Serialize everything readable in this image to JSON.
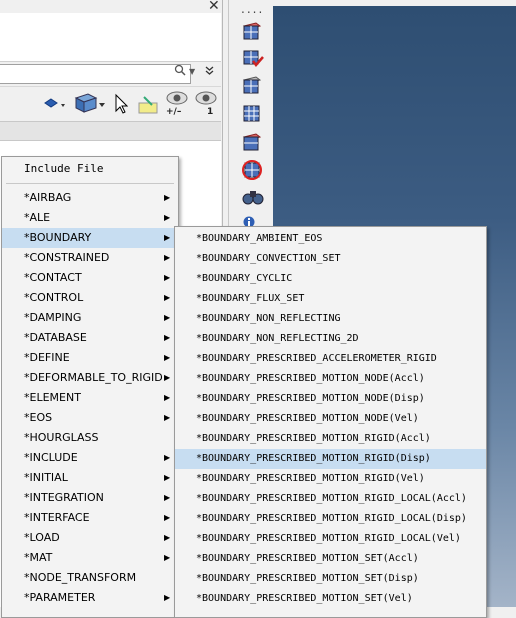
{
  "window": {
    "close_glyph": "✕"
  },
  "search": {
    "value": "",
    "mag_glyph": "🔍",
    "dropdown_glyph": "▼",
    "collapse_glyph": "⌄"
  },
  "toolbar": {
    "icons": [
      "layer-icon",
      "part-display-icon",
      "cursor-select-icon",
      "highlight-icon",
      "view-toggle-icon",
      "view-one-icon"
    ],
    "plusminus_label": "+/–",
    "one_label": "1"
  },
  "vtoolbar": {
    "dots": "....",
    "icons": [
      "mesh-grid-icon",
      "mesh-check-icon",
      "mesh-edit-icon",
      "mesh-grid-2-icon",
      "mesh-face-icon",
      "mesh-circle-icon",
      "binoculars-icon",
      "info-icon"
    ]
  },
  "menu1": {
    "include_label": "Include File",
    "items": [
      {
        "label": "*AIRBAG",
        "sub": true
      },
      {
        "label": "*ALE",
        "sub": true
      },
      {
        "label": "*BOUNDARY",
        "sub": true,
        "selected": true
      },
      {
        "label": "*CONSTRAINED",
        "sub": true
      },
      {
        "label": "*CONTACT",
        "sub": true
      },
      {
        "label": "*CONTROL",
        "sub": true
      },
      {
        "label": "*DAMPING",
        "sub": true
      },
      {
        "label": "*DATABASE",
        "sub": true
      },
      {
        "label": "*DEFINE",
        "sub": true
      },
      {
        "label": "*DEFORMABLE_TO_RIGID",
        "sub": true
      },
      {
        "label": "*ELEMENT",
        "sub": true
      },
      {
        "label": "*EOS",
        "sub": true
      },
      {
        "label": "*HOURGLASS",
        "sub": false
      },
      {
        "label": "*INCLUDE",
        "sub": true
      },
      {
        "label": "*INITIAL",
        "sub": true
      },
      {
        "label": "*INTEGRATION",
        "sub": true
      },
      {
        "label": "*INTERFACE",
        "sub": true
      },
      {
        "label": "*LOAD",
        "sub": true
      },
      {
        "label": "*MAT",
        "sub": true
      },
      {
        "label": "*NODE_TRANSFORM",
        "sub": false
      },
      {
        "label": "*PARAMETER",
        "sub": true
      }
    ]
  },
  "menu2": {
    "items": [
      {
        "label": "*BOUNDARY_AMBIENT_EOS"
      },
      {
        "label": "*BOUNDARY_CONVECTION_SET"
      },
      {
        "label": "*BOUNDARY_CYCLIC"
      },
      {
        "label": "*BOUNDARY_FLUX_SET"
      },
      {
        "label": "*BOUNDARY_NON_REFLECTING"
      },
      {
        "label": "*BOUNDARY_NON_REFLECTING_2D"
      },
      {
        "label": "*BOUNDARY_PRESCRIBED_ACCELEROMETER_RIGID"
      },
      {
        "label": "*BOUNDARY_PRESCRIBED_MOTION_NODE(Accl)"
      },
      {
        "label": "*BOUNDARY_PRESCRIBED_MOTION_NODE(Disp)"
      },
      {
        "label": "*BOUNDARY_PRESCRIBED_MOTION_NODE(Vel)"
      },
      {
        "label": "*BOUNDARY_PRESCRIBED_MOTION_RIGID(Accl)"
      },
      {
        "label": "*BOUNDARY_PRESCRIBED_MOTION_RIGID(Disp)",
        "selected": true
      },
      {
        "label": "*BOUNDARY_PRESCRIBED_MOTION_RIGID(Vel)"
      },
      {
        "label": "*BOUNDARY_PRESCRIBED_MOTION_RIGID_LOCAL(Accl)"
      },
      {
        "label": "*BOUNDARY_PRESCRIBED_MOTION_RIGID_LOCAL(Disp)"
      },
      {
        "label": "*BOUNDARY_PRESCRIBED_MOTION_RIGID_LOCAL(Vel)"
      },
      {
        "label": "*BOUNDARY_PRESCRIBED_MOTION_SET(Accl)"
      },
      {
        "label": "*BOUNDARY_PRESCRIBED_MOTION_SET(Disp)"
      },
      {
        "label": "*BOUNDARY_PRESCRIBED_MOTION_SET(Vel)"
      }
    ]
  },
  "colors": {
    "selection": "#c7ddf1",
    "menu_bg": "#f3f3f3",
    "viewport_top": "#2e4e72",
    "viewport_bottom": "#a4b4c8"
  }
}
